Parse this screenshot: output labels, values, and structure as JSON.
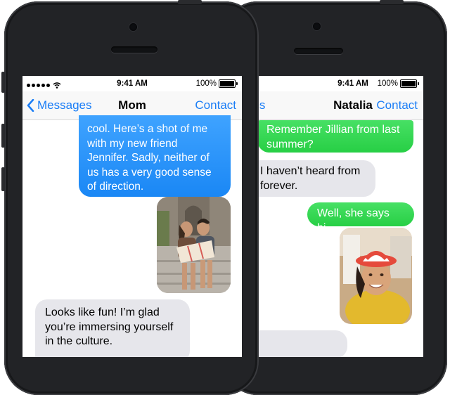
{
  "front_phone": {
    "status": {
      "time": "9:41 AM",
      "battery": "100%"
    },
    "nav": {
      "back_label": "Messages",
      "title": "Mom",
      "action": "Contact"
    },
    "messages": [
      {
        "type": "sent",
        "lines": [
          "cool. Here’s a shot of me",
          "with my new friend",
          "Jennifer. Sadly, neither of",
          "us has a very good sense",
          "of direction."
        ]
      },
      {
        "type": "sent-photo",
        "description": "Two women sitting on steps looking at a map"
      },
      {
        "type": "received",
        "lines": [
          "Looks like fun! I’m glad",
          "you’re immersing yourself",
          "in the culture."
        ]
      }
    ]
  },
  "back_phone": {
    "status": {
      "time": "9:41 AM",
      "battery": "100%"
    },
    "nav": {
      "back_label_partial": "ges",
      "title": "Natalia",
      "action": "Contact"
    },
    "messages": [
      {
        "type": "sent",
        "lines": [
          "Remember Jillian from last",
          "summer?"
        ]
      },
      {
        "type": "received",
        "lines": [
          "I haven’t heard from",
          "forever."
        ]
      },
      {
        "type": "sent",
        "lines": [
          "Well, she says hi."
        ]
      },
      {
        "type": "sent-photo",
        "description": "Smiling woman in a red hat"
      }
    ]
  }
}
